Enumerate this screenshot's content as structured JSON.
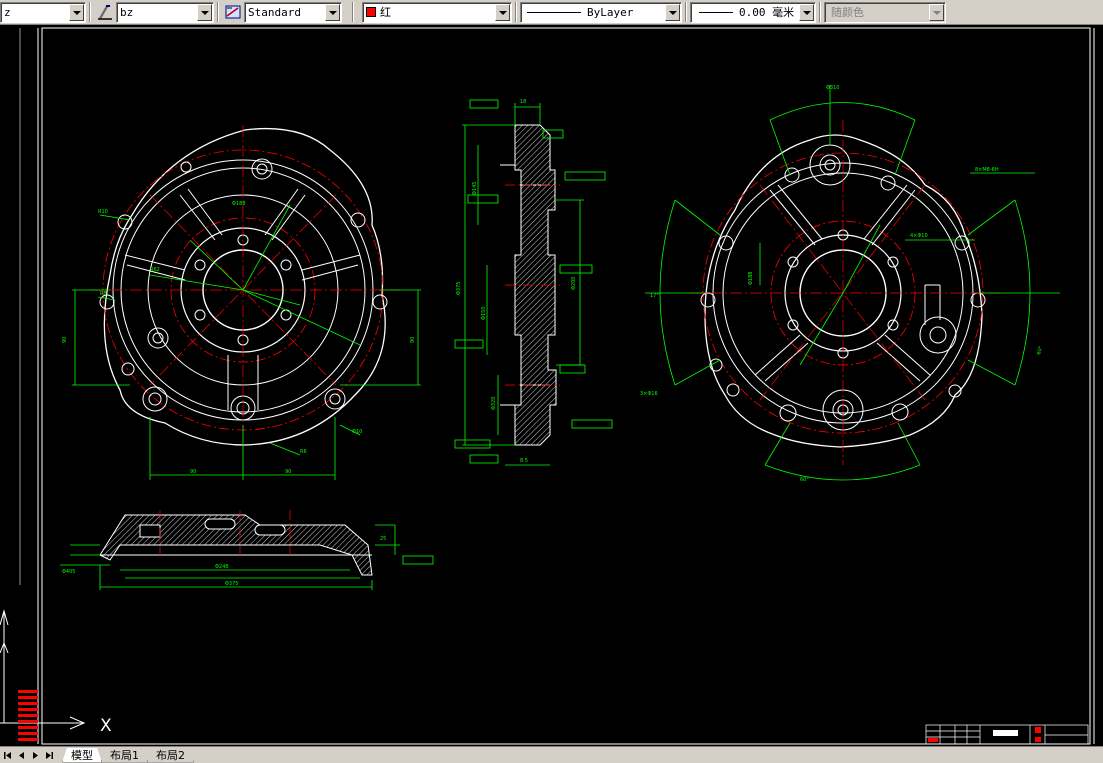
{
  "toolbar": {
    "layer_combo_value": "z",
    "text_style_value": "bz",
    "dim_style_value": "Standard",
    "color_combo": {
      "label": "红",
      "swatch": "#ff0000"
    },
    "linetype_combo": {
      "label": "ByLayer"
    },
    "lineweight_combo": {
      "label": "0.00 毫米"
    },
    "plotstyle_combo": {
      "label": "随颜色"
    },
    "icons": [
      "text-style-icon",
      "dim-style-icon"
    ]
  },
  "canvas": {
    "background": "#000000",
    "colors": {
      "geometry": "#ffffff",
      "dimension": "#00ff00",
      "centerline": "#ff0000",
      "title_block": "#ffffff"
    },
    "ucs_x_label": "X"
  },
  "tabs": [
    {
      "label": "模型",
      "active": true
    },
    {
      "label": "布局1",
      "active": false
    },
    {
      "label": "布局2",
      "active": false
    }
  ]
}
